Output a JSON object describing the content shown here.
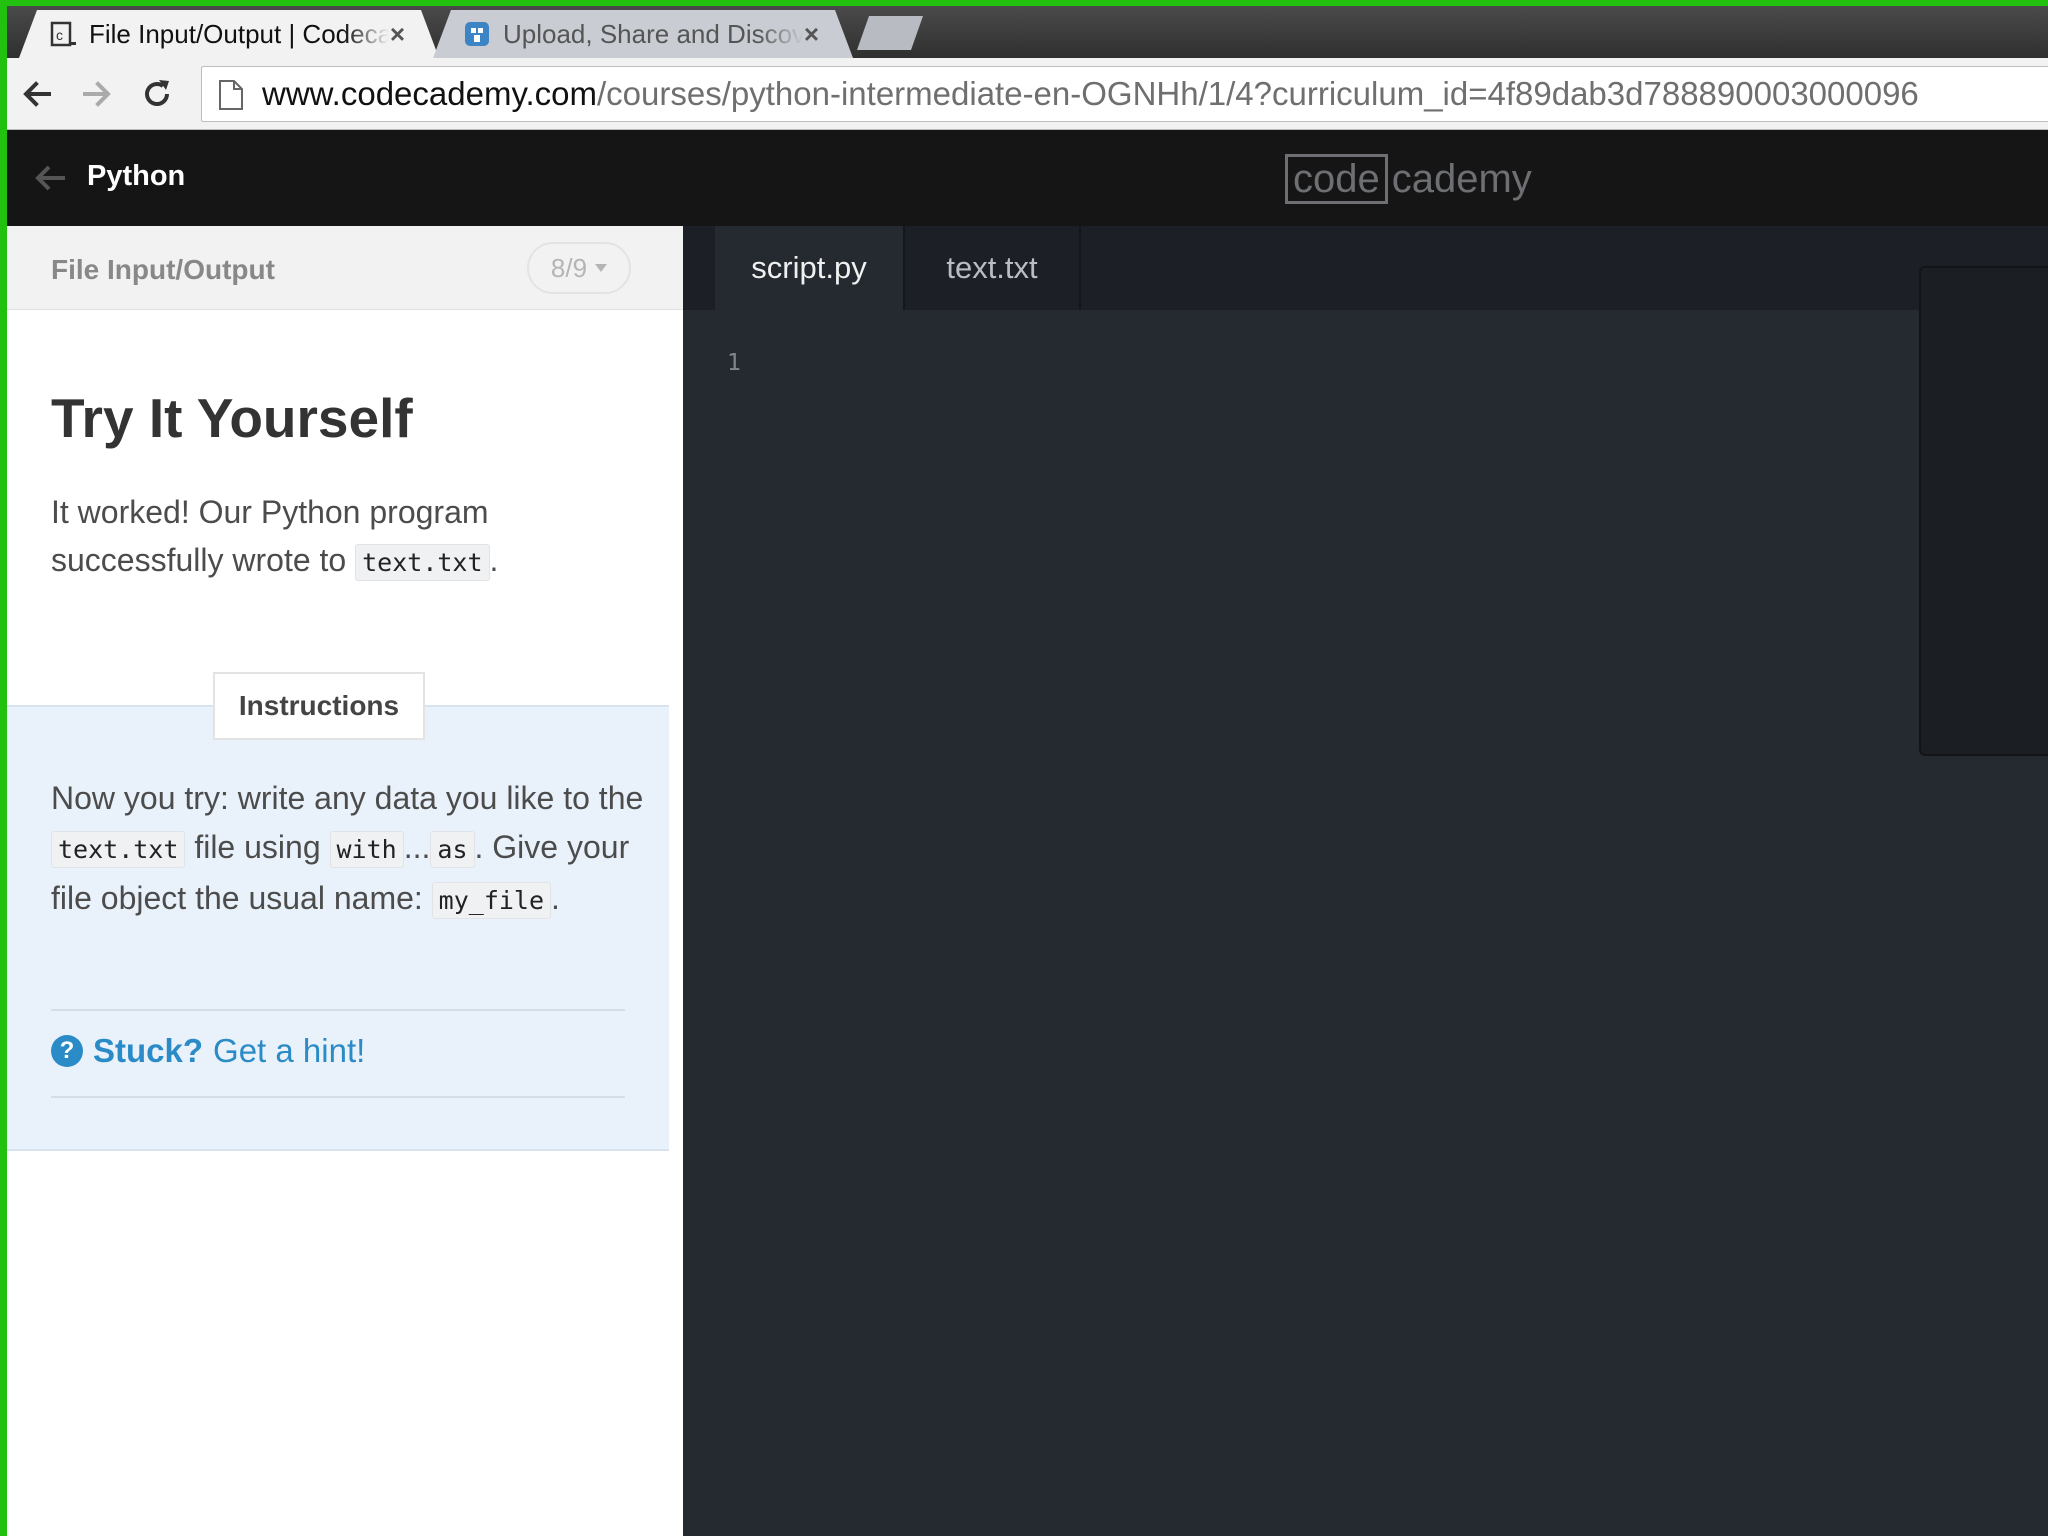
{
  "browser": {
    "tabs": [
      {
        "title": "File Input/Output | Codecademy",
        "active": true,
        "icon": "codecademy-favicon-icon"
      },
      {
        "title": "Upload, Share and Discover",
        "active": false,
        "icon": "share-favicon-icon"
      }
    ],
    "close_glyph": "×",
    "url_host": "www.codecademy.com",
    "url_path": "/courses/python-intermediate-en-OGNHh/1/4?curriculum_id=4f89dab3d788890003000096"
  },
  "header": {
    "course": "Python",
    "logo_code": "code",
    "logo_cademy": "cademy"
  },
  "lesson": {
    "name": "File Input/Output",
    "progress": "8/9",
    "heading": "Try It Yourself",
    "intro_before": "It worked! Our Python program successfully wrote to ",
    "intro_code": "text.txt",
    "intro_after": ".",
    "instructions_tab": "Instructions",
    "instr": {
      "t1": "Now you try: write any data you like to the ",
      "c1": "text.txt",
      "t2": " file using ",
      "c2": "with",
      "t3": "...",
      "c3": "as",
      "t4": ". Give your file object the usual name: ",
      "c4": "my_file",
      "t5": "."
    },
    "hint_stuck": "Stuck?",
    "hint_link": "Get a hint!"
  },
  "editor": {
    "tabs": [
      "script.py",
      "text.txt"
    ],
    "active_tab": "script.py",
    "line_numbers": [
      "1"
    ]
  },
  "colors": {
    "green_border": "#22c10f",
    "header_bg": "#151515",
    "editor_bg": "#252a31",
    "instructions_bg": "#e9f2fb",
    "hint_blue": "#2b8bc6"
  }
}
